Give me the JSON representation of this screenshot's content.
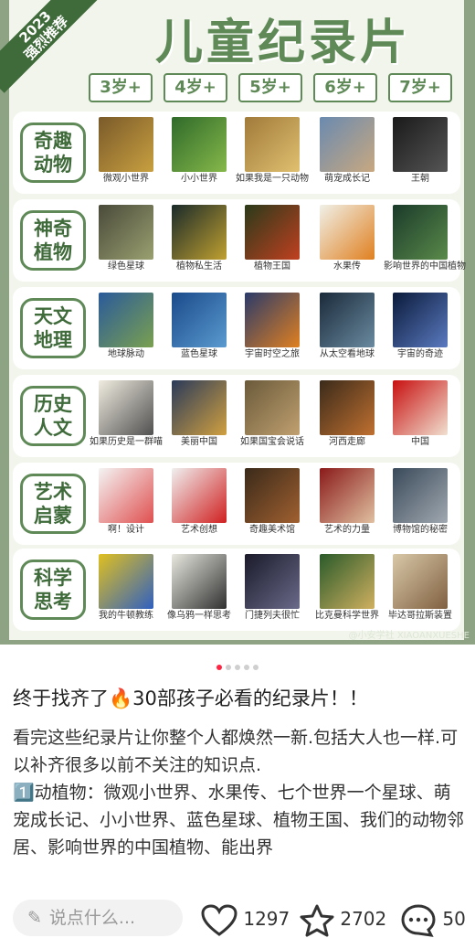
{
  "poster": {
    "corner_line1": "2023",
    "corner_line2": "强烈推荐",
    "title": "儿童纪录片",
    "ages": [
      "3岁+",
      "4岁+",
      "5岁+",
      "6岁+",
      "7岁+"
    ],
    "watermark": "@小安学社 XIAOANXUESHE",
    "rows": [
      {
        "cat1": "奇趣",
        "cat2": "动物",
        "items": [
          {
            "caption": "微观小世界",
            "color": "#7a5a2a",
            "color2": "#c8a040"
          },
          {
            "caption": "小小世界",
            "color": "#2f6a2a",
            "color2": "#86b84a"
          },
          {
            "caption": "如果我是一只动物",
            "color": "#a07a3a",
            "color2": "#e0c070"
          },
          {
            "caption": "萌宠成长记",
            "color": "#6a8ab0",
            "color2": "#c8a880"
          },
          {
            "caption": "王朝",
            "color": "#1a1a1a",
            "color2": "#555555"
          }
        ]
      },
      {
        "cat1": "神奇",
        "cat2": "植物",
        "items": [
          {
            "caption": "绿色星球",
            "color": "#4a4a3a",
            "color2": "#9aa070"
          },
          {
            "caption": "植物私生活",
            "color": "#1a2a2a",
            "color2": "#c0a030"
          },
          {
            "caption": "植物王国",
            "color": "#2a3a1a",
            "color2": "#c04020"
          },
          {
            "caption": "水果传",
            "color": "#f0f0e8",
            "color2": "#e08020"
          },
          {
            "caption": "影响世界的中国植物",
            "color": "#1a3a2a",
            "color2": "#5a8a4a"
          }
        ]
      },
      {
        "cat1": "天文",
        "cat2": "地理",
        "items": [
          {
            "caption": "地球脉动",
            "color": "#2a5a9a",
            "color2": "#7aa050"
          },
          {
            "caption": "蓝色星球",
            "color": "#1a4a8a",
            "color2": "#5a9ad0"
          },
          {
            "caption": "宇宙时空之旅",
            "color": "#2a3a6a",
            "color2": "#e08020"
          },
          {
            "caption": "从太空看地球",
            "color": "#1a2a3a",
            "color2": "#6a8aa0"
          },
          {
            "caption": "宇宙的奇迹",
            "color": "#0a1a3a",
            "color2": "#5a7ac0"
          }
        ]
      },
      {
        "cat1": "历史",
        "cat2": "人文",
        "items": [
          {
            "caption": "如果历史是一群喵",
            "color": "#f0ece0",
            "color2": "#505050"
          },
          {
            "caption": "美丽中国",
            "color": "#2a3a5a",
            "color2": "#d0a040"
          },
          {
            "caption": "如果国宝会说话",
            "color": "#6a5a3a",
            "color2": "#c0a070"
          },
          {
            "caption": "河西走廊",
            "color": "#3a2a1a",
            "color2": "#c07030"
          },
          {
            "caption": "中国",
            "color": "#c81010",
            "color2": "#f0e0d0"
          }
        ]
      },
      {
        "cat1": "艺术",
        "cat2": "启蒙",
        "items": [
          {
            "caption": "啊！设计",
            "color": "#f4f4f4",
            "color2": "#e05050"
          },
          {
            "caption": "艺术创想",
            "color": "#f0f0f0",
            "color2": "#d02020"
          },
          {
            "caption": "奇趣美术馆",
            "color": "#3a2a1a",
            "color2": "#a06030"
          },
          {
            "caption": "艺术的力量",
            "color": "#8a1a1a",
            "color2": "#e0c0a0"
          },
          {
            "caption": "博物馆的秘密",
            "color": "#3a4a5a",
            "color2": "#a0a8b0"
          }
        ]
      },
      {
        "cat1": "科学",
        "cat2": "思考",
        "items": [
          {
            "caption": "我的牛顿教练",
            "color": "#e0c020",
            "color2": "#3060c0"
          },
          {
            "caption": "像乌鸦一样思考",
            "color": "#e8e8e0",
            "color2": "#303030"
          },
          {
            "caption": "门捷列夫很忙",
            "color": "#1a1a2a",
            "color2": "#6a6a8a"
          },
          {
            "caption": "比克曼科学世界",
            "color": "#2a5a2a",
            "color2": "#d0b060"
          },
          {
            "caption": "毕达哥拉斯装置",
            "color": "#d8c8a8",
            "color2": "#806040"
          }
        ]
      }
    ]
  },
  "pager": {
    "total": 5,
    "active": 0
  },
  "post": {
    "title": "终于找齐了🔥30部孩子必看的纪录片！！",
    "body": "看完这些纪录片让你整个人都焕然一新.包括大人也一样.可以补齐很多以前不关注的知识点.\n1️⃣动植物：微观小世界、水果传、七个世界一个星球、萌宠成长记、小小世界、蓝色星球、植物王国、我们的动物邻居、影响世界的中国植物、能出界"
  },
  "bottombar": {
    "comment_placeholder": "说点什么...",
    "likes": "1297",
    "stars": "2702",
    "comments": "50"
  },
  "colors": {
    "accent": "#5f8a57",
    "dark_green": "#3f6a3a",
    "active_dot": "#ff2442"
  }
}
